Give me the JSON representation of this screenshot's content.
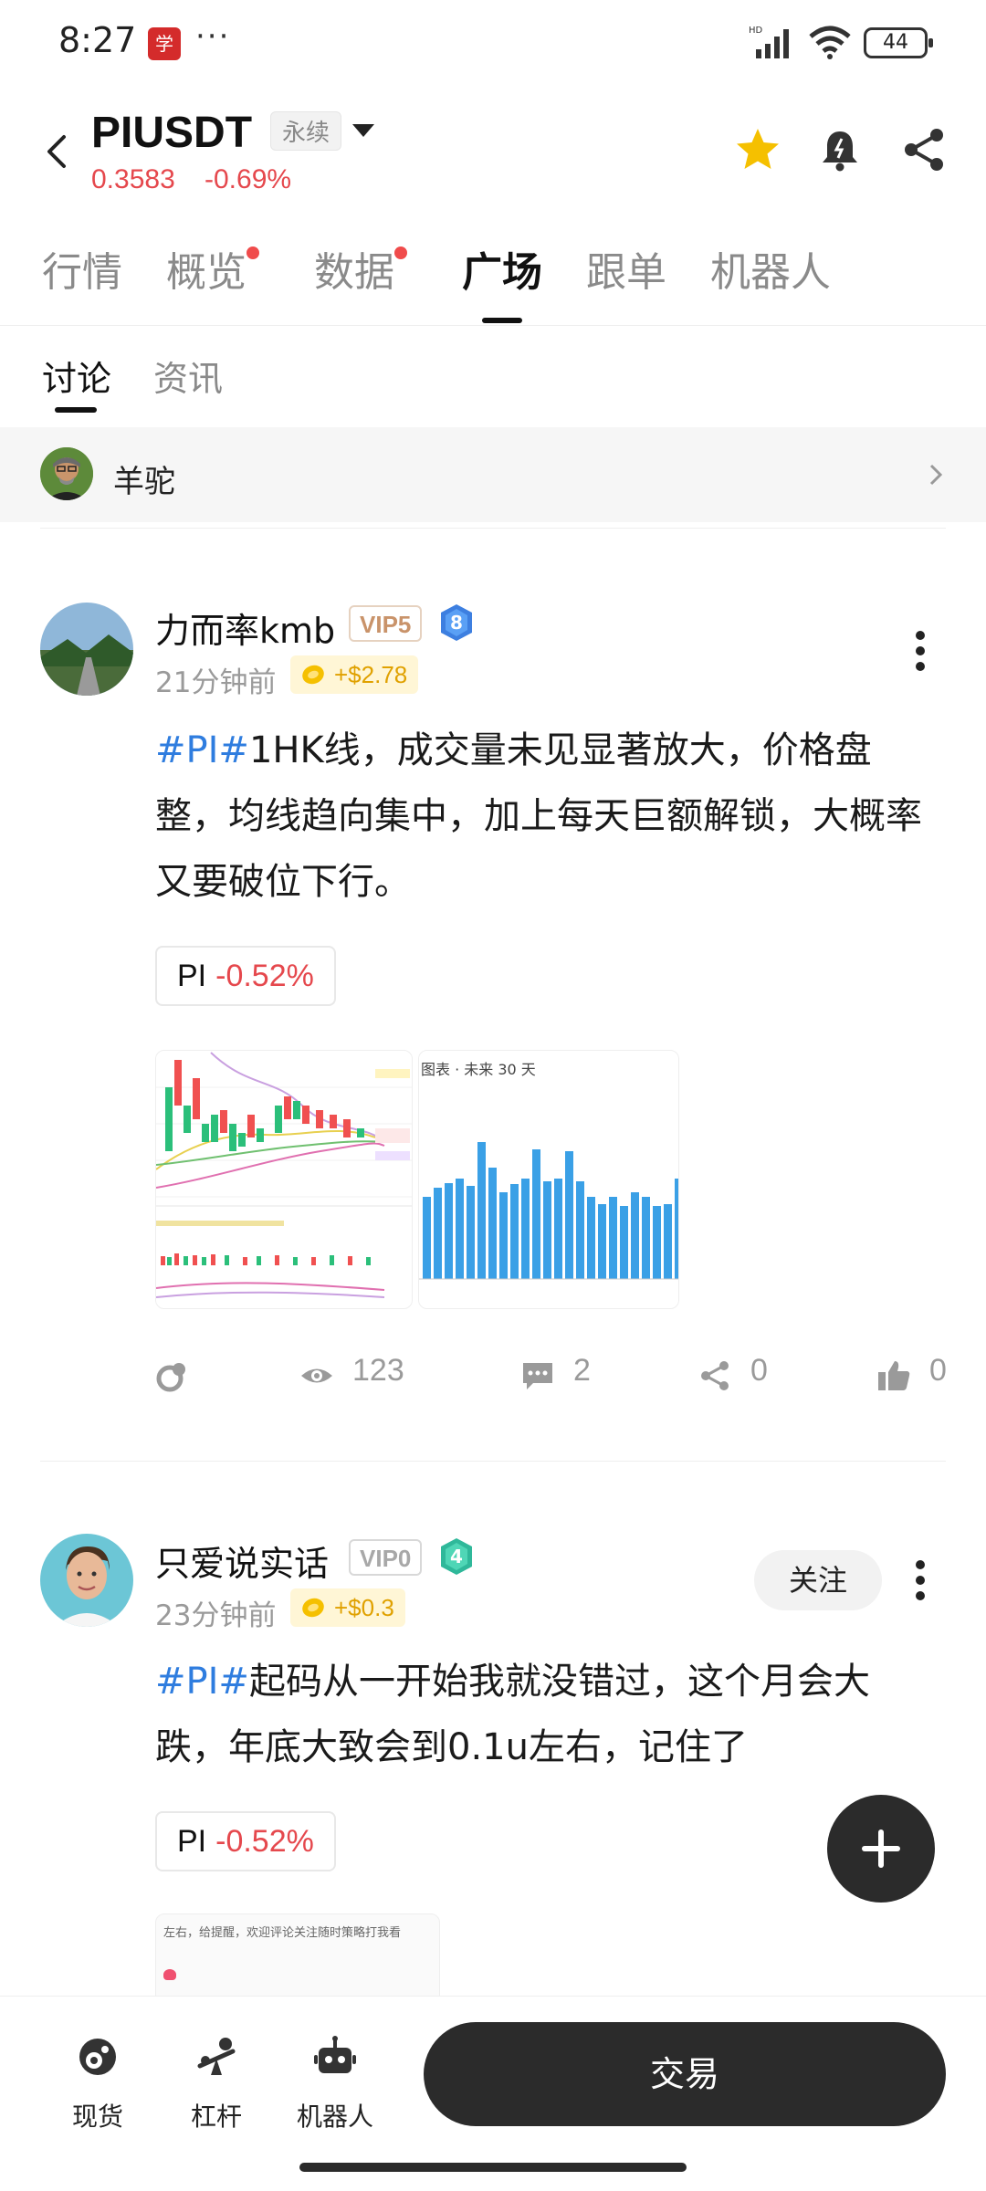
{
  "status": {
    "time": "8:27",
    "app_badge": "学",
    "dots": "···",
    "battery": "44"
  },
  "header": {
    "pair": "PIUSDT",
    "contract_tag": "永续",
    "price": "0.3583",
    "change": "-0.69%"
  },
  "tabs": [
    {
      "label": "行情"
    },
    {
      "label": "概览"
    },
    {
      "label": "数据"
    },
    {
      "label": "广场"
    },
    {
      "label": "跟单"
    },
    {
      "label": "机器人"
    }
  ],
  "subtabs": [
    {
      "label": "讨论"
    },
    {
      "label": "资讯"
    }
  ],
  "banner": {
    "name": "羊驼"
  },
  "posts": [
    {
      "author": "力而率kmb",
      "vip": "VIP5",
      "level": "8",
      "time": "21分钟前",
      "tip": "+$2.78",
      "hashtag": "#PI#",
      "text": "1HK线，成交量未见显著放大，价格盘整，均线趋向集中，加上每天巨额解锁，大概率又要破位下行。",
      "coin": {
        "symbol": "PI",
        "change": "-0.52%"
      },
      "thumb2_title": "图表 · 未来 30 天",
      "stats": {
        "views": "123",
        "comments": "2",
        "shares": "0",
        "likes": "0"
      }
    },
    {
      "author": "只爱说实话",
      "vip": "VIP0",
      "level": "4",
      "time": "23分钟前",
      "tip": "+$0.3",
      "follow": "关注",
      "hashtag": "#PI#",
      "text": "起码从一开始我就没错过，这个月会大跌，年底大致会到0.1u左右，记住了",
      "coin": {
        "symbol": "PI",
        "change": "-0.52%"
      },
      "thumb_text": "左右，给提醒，欢迎评论关注随时策略打我看"
    }
  ],
  "bottom_nav": [
    {
      "label": "现货"
    },
    {
      "label": "杠杆"
    },
    {
      "label": "机器人"
    }
  ],
  "trade_button": "交易",
  "colors": {
    "down": "#e5484d",
    "hashtag": "#2f7ddf",
    "star": "#f5c000",
    "dark": "#2b2b2b",
    "tip_text": "#e0a100"
  },
  "icons": [
    "back-icon",
    "dropdown-caret-icon",
    "star-icon",
    "alarm-bell-icon",
    "share-icon",
    "chevron-right-icon",
    "coin-icon",
    "more-vertical-icon",
    "repost-icon",
    "eye-icon",
    "comment-icon",
    "share-icon",
    "thumbs-up-icon",
    "plus-icon",
    "spot-icon",
    "leverage-icon",
    "robot-icon"
  ]
}
